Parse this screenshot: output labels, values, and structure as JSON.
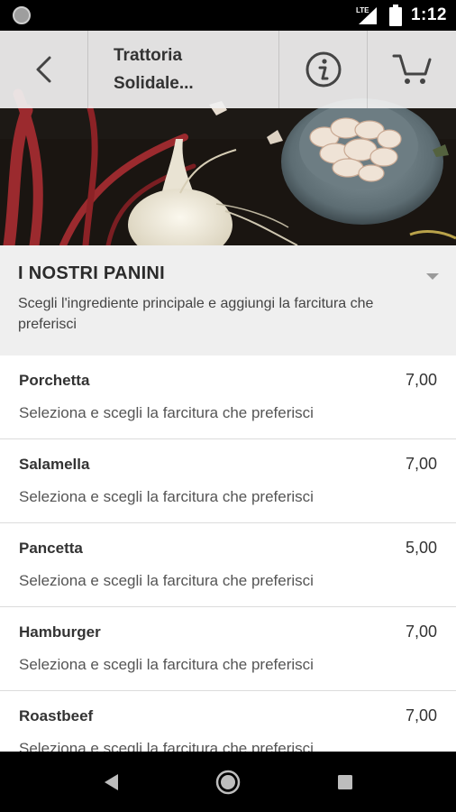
{
  "status_bar": {
    "network": "LTE",
    "time": "1:12"
  },
  "app_bar": {
    "title": "Trattoria\nSolidale...",
    "icons": [
      "back-arrow-icon",
      "info-icon",
      "cart-icon"
    ]
  },
  "section": {
    "title": "I NOSTRI PANINI",
    "description": "Scegli l'ingrediente principale e aggiungi la farcitura che preferisci"
  },
  "items": [
    {
      "name": "Porchetta",
      "price": "7,00",
      "description": "Seleziona e scegli la farcitura che preferisci"
    },
    {
      "name": "Salamella",
      "price": "7,00",
      "description": "Seleziona e scegli la farcitura che preferisci"
    },
    {
      "name": "Pancetta",
      "price": "5,00",
      "description": "Seleziona e scegli la farcitura che preferisci"
    },
    {
      "name": "Hamburger",
      "price": "7,00",
      "description": "Seleziona e scegli la farcitura che preferisci"
    },
    {
      "name": "Roastbeef",
      "price": "7,00",
      "description": "Seleziona e scegli la farcitura che preferisci"
    }
  ],
  "nav_bar": {
    "icons": [
      "back-triangle-icon",
      "home-circle-icon",
      "recents-square-icon"
    ]
  },
  "colors": {
    "status_bg": "#000000",
    "app_bar_bg": "#f0f0f0",
    "section_bg": "#efefef",
    "list_bg": "#ffffff",
    "text_dark": "#333333",
    "text_muted": "#555555"
  }
}
